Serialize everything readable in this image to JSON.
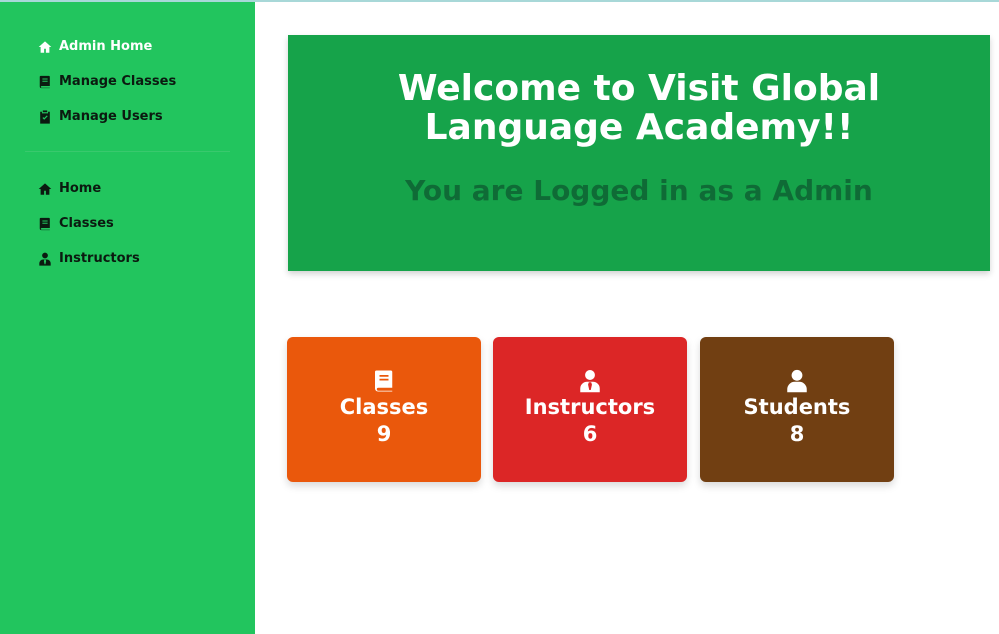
{
  "sidebar": {
    "admin_nav": [
      {
        "label": "Admin Home",
        "icon": "home-icon"
      },
      {
        "label": "Manage Classes",
        "icon": "book-icon"
      },
      {
        "label": "Manage Users",
        "icon": "clipboard-check-icon"
      }
    ],
    "public_nav": [
      {
        "label": "Home",
        "icon": "home-icon"
      },
      {
        "label": "Classes",
        "icon": "book-icon"
      },
      {
        "label": "Instructors",
        "icon": "user-tie-icon"
      }
    ]
  },
  "hero": {
    "title": "Welcome to Visit Global Language Academy!!",
    "subtitle": "You are Logged in as a Admin"
  },
  "stats": [
    {
      "label": "Classes",
      "value": "9",
      "icon": "book-icon",
      "color": "#ea580c"
    },
    {
      "label": "Instructors",
      "value": "6",
      "icon": "user-tie-icon",
      "color": "#dc2626"
    },
    {
      "label": "Students",
      "value": "8",
      "icon": "user-icon",
      "color": "#713f12"
    }
  ],
  "colors": {
    "sidebar": "#22c55e",
    "hero": "#16a34a",
    "hero_subtitle": "#0f6b36"
  }
}
